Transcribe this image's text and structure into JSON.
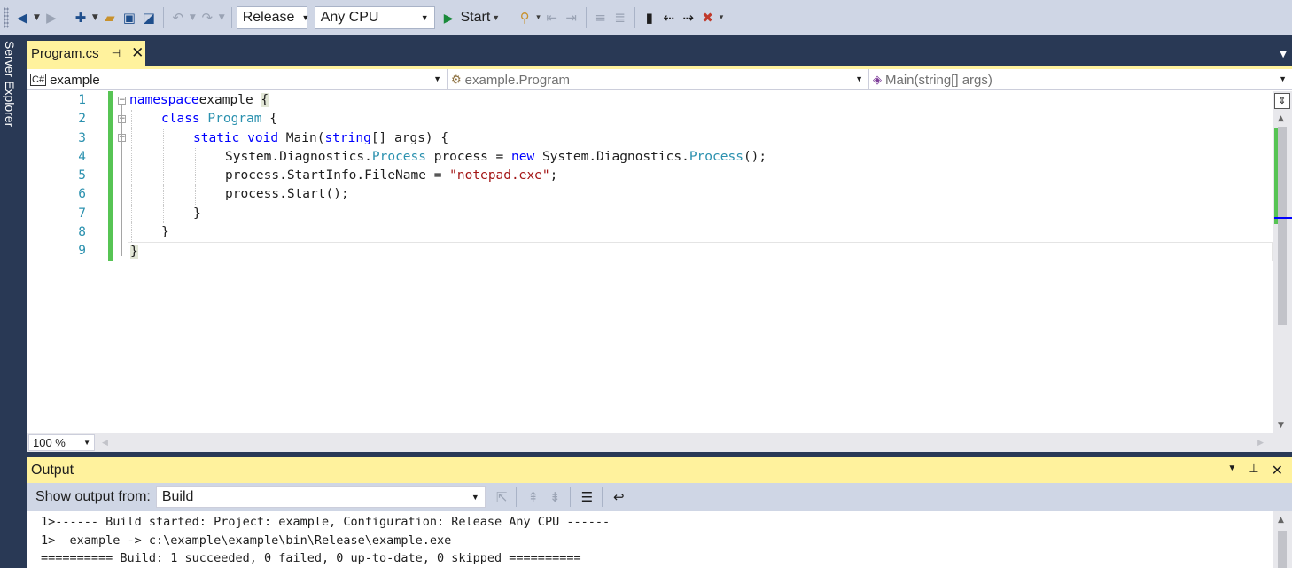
{
  "toolbar": {
    "configuration": "Release",
    "platform": "Any CPU",
    "start_label": "Start"
  },
  "side_tab": {
    "label": "Server Explorer"
  },
  "document_tab": {
    "title": "Program.cs"
  },
  "nav_bar": {
    "project": "example",
    "type": "example.Program",
    "member": "Main(string[] args)"
  },
  "editor": {
    "line_numbers": [
      "1",
      "2",
      "3",
      "4",
      "5",
      "6",
      "7",
      "8",
      "9"
    ],
    "lines": [
      {
        "tokens": [
          [
            "kw",
            "namespace"
          ],
          [
            "",
            "example "
          ],
          [
            "brace",
            "{"
          ]
        ]
      },
      {
        "indent": 1,
        "tokens": [
          [
            "kw",
            "class"
          ],
          [
            "",
            " "
          ],
          [
            "ty",
            "Program"
          ],
          [
            "",
            " {"
          ]
        ]
      },
      {
        "indent": 2,
        "tokens": [
          [
            "kw",
            "static"
          ],
          [
            "",
            " "
          ],
          [
            "kw",
            "void"
          ],
          [
            "",
            " Main("
          ],
          [
            "kw",
            "string"
          ],
          [
            "",
            "[] args) {"
          ]
        ]
      },
      {
        "indent": 3,
        "tokens": [
          [
            "",
            "System.Diagnostics."
          ],
          [
            "ty",
            "Process"
          ],
          [
            "",
            " process = "
          ],
          [
            "kw",
            "new"
          ],
          [
            "",
            " System.Diagnostics."
          ],
          [
            "ty",
            "Process"
          ],
          [
            "",
            "();"
          ]
        ]
      },
      {
        "indent": 3,
        "tokens": [
          [
            "",
            "process.StartInfo.FileName = "
          ],
          [
            "st",
            "\"notepad.exe\""
          ],
          [
            "",
            ";"
          ]
        ]
      },
      {
        "indent": 3,
        "tokens": [
          [
            "",
            "process.Start();"
          ]
        ]
      },
      {
        "indent": 2,
        "tokens": [
          [
            "",
            "}"
          ]
        ]
      },
      {
        "indent": 1,
        "tokens": [
          [
            "",
            "}"
          ]
        ]
      },
      {
        "indent": 0,
        "current": true,
        "tokens": [
          [
            "brace",
            "}"
          ]
        ]
      }
    ]
  },
  "zoom": {
    "value": "100 %"
  },
  "output": {
    "title": "Output",
    "show_from_label": "Show output from:",
    "source": "Build",
    "lines": [
      "1>------ Build started: Project: example, Configuration: Release Any CPU ------",
      "1>  example -> c:\\example\\example\\bin\\Release\\example.exe",
      "========== Build: 1 succeeded, 0 failed, 0 up-to-date, 0 skipped =========="
    ]
  }
}
